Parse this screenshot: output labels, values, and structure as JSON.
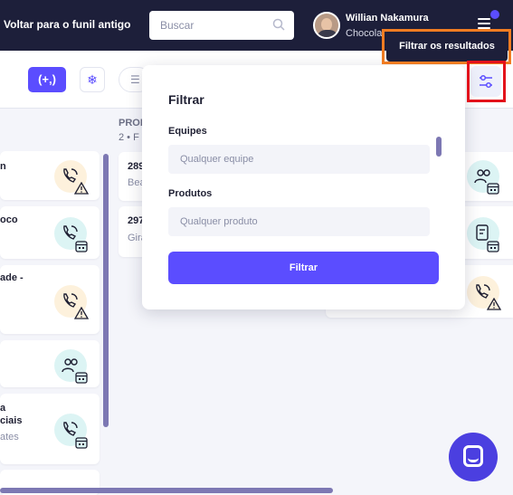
{
  "header": {
    "back_label": "Voltar para o funil antigo",
    "search_placeholder": "Buscar",
    "user_name": "Willian Nakamura",
    "company": "Chocola"
  },
  "toolbar": {
    "add_label": "(+,)",
    "snow_glyph": "❄",
    "list_glyph": "☰",
    "filter_tooltip": "Filtrar os resultados"
  },
  "columns": {
    "left_cards": [
      {
        "title": "n",
        "subtitle": "",
        "icon": "phone-warning-icon"
      },
      {
        "title": "oco",
        "subtitle": "",
        "icon": "phone-calendar-icon"
      },
      {
        "title": "ade -",
        "subtitle": "",
        "icon": "phone-warning-icon"
      },
      {
        "title": "",
        "subtitle": "",
        "icon": "people-calendar-icon"
      },
      {
        "title": "a",
        "title2": "ciais",
        "subtitle": "ates",
        "icon": "phone-calendar-icon"
      }
    ],
    "mid_header": "PROF",
    "mid_count": "2 • F",
    "mid_cards": [
      {
        "title": "289",
        "subtitle": "Bea"
      },
      {
        "title": "297",
        "subtitle": "Gira"
      }
    ]
  },
  "filter_popup": {
    "title": "Filtrar",
    "teams_label": "Equipes",
    "teams_placeholder": "Qualquer equipe",
    "products_label": "Produtos",
    "products_placeholder": "Qualquer produto",
    "apply_label": "Filtrar"
  },
  "colors": {
    "accent": "#5b4dff",
    "header_bg": "#1d1f3a",
    "highlight_red": "#e3121b",
    "highlight_orange": "#f07c22"
  }
}
